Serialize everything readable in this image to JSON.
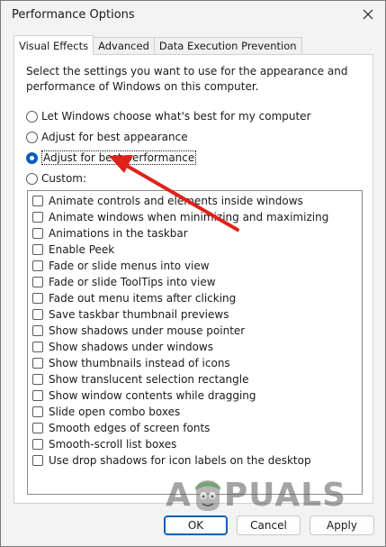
{
  "window": {
    "title": "Performance Options"
  },
  "tabs": [
    {
      "label": "Visual Effects",
      "active": true
    },
    {
      "label": "Advanced",
      "active": false
    },
    {
      "label": "Data Execution Prevention",
      "active": false
    }
  ],
  "description": "Select the settings you want to use for the appearance and performance of Windows on this computer.",
  "radios": [
    {
      "label": "Let Windows choose what's best for my computer",
      "checked": false
    },
    {
      "label": "Adjust for best appearance",
      "checked": false
    },
    {
      "label": "Adjust for best performance",
      "checked": true
    },
    {
      "label": "Custom:",
      "checked": false
    }
  ],
  "effects": [
    "Animate controls and elements inside windows",
    "Animate windows when minimizing and maximizing",
    "Animations in the taskbar",
    "Enable Peek",
    "Fade or slide menus into view",
    "Fade or slide ToolTips into view",
    "Fade out menu items after clicking",
    "Save taskbar thumbnail previews",
    "Show shadows under mouse pointer",
    "Show shadows under windows",
    "Show thumbnails instead of icons",
    "Show translucent selection rectangle",
    "Show window contents while dragging",
    "Slide open combo boxes",
    "Smooth edges of screen fonts",
    "Smooth-scroll list boxes",
    "Use drop shadows for icon labels on the desktop"
  ],
  "buttons": {
    "ok": "OK",
    "cancel": "Cancel",
    "apply": "Apply"
  },
  "watermark": {
    "left": "A",
    "right": "PUALS"
  },
  "colors": {
    "accent": "#005fb8",
    "arrow": "#e0211b"
  }
}
